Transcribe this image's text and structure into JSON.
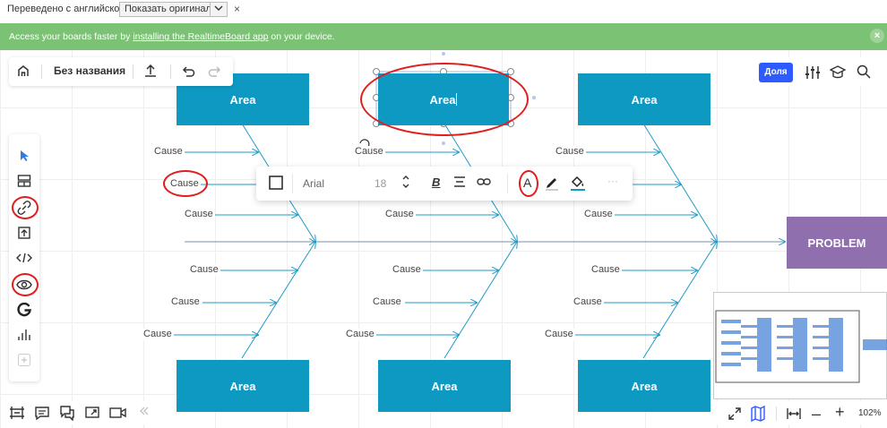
{
  "translate_bar": {
    "text": "Переведено с английского",
    "show_original": "Показать оригинал",
    "options": "✓",
    "close": "×"
  },
  "banner": {
    "text_before": "Access your boards faster by ",
    "link": "installing the RealtimeBoard app",
    "text_after": " on your device.",
    "close": "×"
  },
  "header": {
    "board_name": "Без названия"
  },
  "right_panel": {
    "share_label": "Доля",
    "zoom_level": "102%"
  },
  "format_toolbar": {
    "font": "Arial",
    "font_size": "18",
    "bold": "B",
    "color_letter": "A",
    "more": "···"
  },
  "diagram": {
    "area_label": "Area",
    "editing_area_label": "Area",
    "problem_label": "PROBLEM",
    "cause_label": "Cause"
  },
  "colors": {
    "area": "#0e99c3",
    "problem": "#8f6fae",
    "banner": "#7bc275",
    "share": "#2d5bff",
    "annotation": "#e01e1e",
    "connector": "#1c9bc6"
  }
}
